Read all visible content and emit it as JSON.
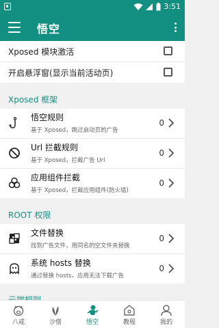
{
  "statusbar": {
    "time": "3:51"
  },
  "appbar": {
    "title": "悟空"
  },
  "settings": [
    {
      "label": "Xposed 模块激活"
    },
    {
      "label": "开启悬浮窗(显示当前活动页)"
    }
  ],
  "sections": {
    "xposed": {
      "title": "Xposed 框架"
    },
    "root": {
      "title": "ROOT 权限"
    }
  },
  "cards": [
    {
      "title": "悟空规则",
      "subtitle": "基于 Xposed，跳过启动页的广告",
      "count": "0",
      "icon": "hook-icon"
    },
    {
      "title": "Url 拦截规则",
      "subtitle": "基于 Xposed，拦截广告 Url",
      "count": "0",
      "icon": "block-icon"
    },
    {
      "title": "应用组件拦截",
      "subtitle": "基于 Xposed，拦截应用组件(防火墙)",
      "count": "0",
      "icon": "components-icon"
    },
    {
      "title": "文件替换",
      "subtitle": "找到广告文件，用同名的空文件夹替换",
      "count": "0",
      "icon": "file-replace-icon"
    },
    {
      "title": "系统 hosts 替换",
      "subtitle": "通过替换 hosts，应用无法下载广告",
      "count": "0",
      "icon": "ghost-icon"
    }
  ],
  "peek": {
    "text": "云端规则"
  },
  "bottomnav": [
    {
      "label": "八戒",
      "icon": "pig-icon"
    },
    {
      "label": "沙僧",
      "icon": "leaf-icon"
    },
    {
      "label": "悟空",
      "icon": "monkey-icon",
      "active": true
    },
    {
      "label": "教程",
      "icon": "home-icon"
    },
    {
      "label": "我的",
      "icon": "person-icon"
    }
  ],
  "colors": {
    "primary": "#128f80",
    "accent": "#14907f",
    "background": "#f1f1f1"
  }
}
